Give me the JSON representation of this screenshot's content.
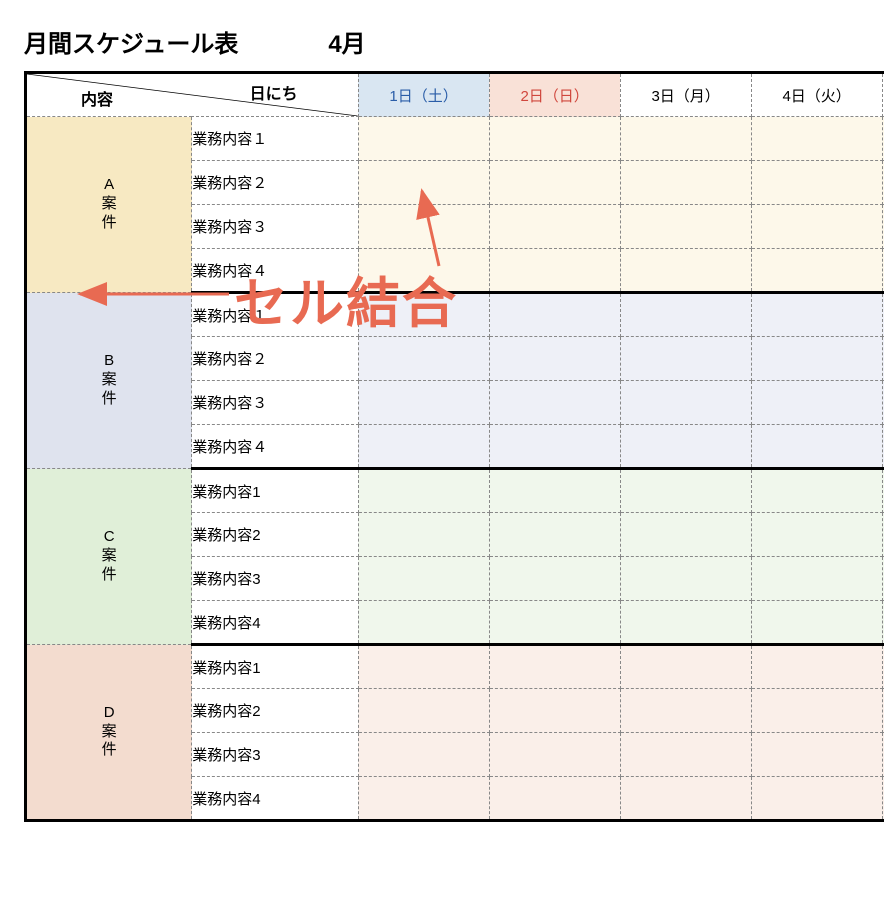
{
  "header": {
    "title": "月間スケジュール表",
    "month": "4月",
    "corner_day_label": "日にち",
    "corner_content_label": "内容"
  },
  "days": [
    {
      "label": "1日（土）",
      "kind": "sat"
    },
    {
      "label": "2日（日）",
      "kind": "sun"
    },
    {
      "label": "3日（月）",
      "kind": "wk"
    },
    {
      "label": "4日（火）",
      "kind": "wk"
    },
    {
      "label": "",
      "kind": "wk"
    }
  ],
  "projects": [
    {
      "code": "A",
      "label_chars": [
        "A",
        "案",
        "件"
      ],
      "color_class": "a",
      "tasks": [
        "業務内容１",
        "業務内容２",
        "業務内容３",
        "業務内容４"
      ]
    },
    {
      "code": "B",
      "label_chars": [
        "B",
        "案",
        "件"
      ],
      "color_class": "b",
      "tasks": [
        "業務内容１",
        "業務内容２",
        "業務内容３",
        "業務内容４"
      ]
    },
    {
      "code": "C",
      "label_chars": [
        "C",
        "案",
        "件"
      ],
      "color_class": "c",
      "tasks": [
        "業務内容1",
        "業務内容2",
        "業務内容3",
        "業務内容4"
      ]
    },
    {
      "code": "D",
      "label_chars": [
        "D",
        "案",
        "件"
      ],
      "color_class": "d",
      "tasks": [
        "業務内容1",
        "業務内容2",
        "業務内容3",
        "業務内容4"
      ]
    }
  ],
  "annotation": {
    "label": "セル結合",
    "color": "#e86a52"
  }
}
